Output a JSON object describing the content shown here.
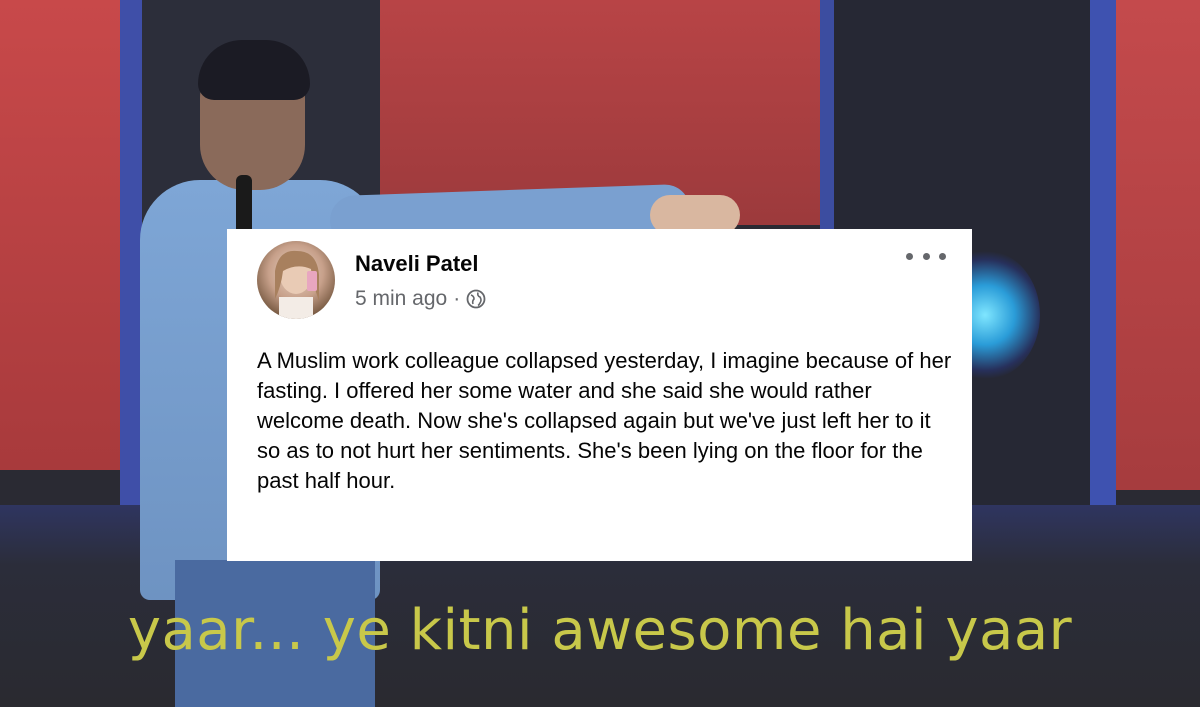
{
  "post": {
    "author": "Naveli Patel",
    "time": "5 min ago",
    "separator": "·",
    "privacy_icon": "globe-icon",
    "more_icon": "more-options-icon",
    "text": "A Muslim work colleague collapsed yesterday, I imagine because of her fasting. I offered her some water and she said she would rather welcome death. Now she's collapsed again but we've just left her to it so as to not hurt her sentiments. She's been lying on the floor for the past half hour."
  },
  "caption": "yaar... ye kitni awesome hai yaar",
  "colors": {
    "caption": "#c8c84a",
    "stage_red": "#b84446",
    "stage_blue": "#3e52b0",
    "card_bg": "#ffffff",
    "meta_gray": "#65676b"
  }
}
